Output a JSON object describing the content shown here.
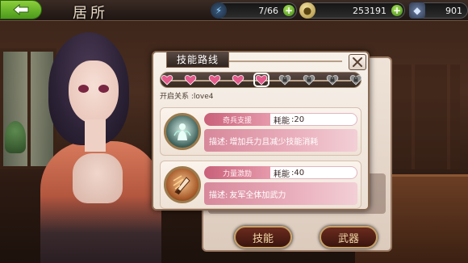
{
  "header": {
    "back_icon": "back-arrow-icon",
    "title": "居所",
    "stats": {
      "energy": {
        "icon": "lightning-icon",
        "value": "7/66"
      },
      "gold": {
        "icon": "coin-icon",
        "value": "253191"
      },
      "gems": {
        "icon": "gem-icon",
        "value": "901"
      }
    }
  },
  "popup": {
    "tab_label": "技能路线",
    "path_nodes": [
      {
        "state": "unlocked",
        "icon": "heart-icon"
      },
      {
        "state": "unlocked",
        "icon": "heart-icon"
      },
      {
        "state": "unlocked",
        "icon": "heart-icon"
      },
      {
        "state": "unlocked",
        "icon": "heart-icon"
      },
      {
        "state": "current",
        "icon": "heart-icon"
      },
      {
        "state": "locked",
        "icon": "lock-icon"
      },
      {
        "state": "locked",
        "icon": "lock-icon"
      },
      {
        "state": "locked",
        "icon": "lock-icon"
      },
      {
        "state": "locked",
        "icon": "lock-icon"
      }
    ],
    "unlock_text": "开启关系 :love4",
    "skills": [
      {
        "name": "奇兵支援",
        "cost_label": "耗能",
        "cost_value": ":20",
        "desc_prefix": "描述:",
        "description": "增加兵力且减少技能消耗",
        "icon": "spirit-figure-icon"
      },
      {
        "name": "力量激励",
        "cost_label": "耗能",
        "cost_value": ":40",
        "desc_prefix": "描述:",
        "description": "友军全体加武力",
        "icon": "power-blade-icon"
      }
    ]
  },
  "buttons": {
    "skill": "技能",
    "weapon": "武器"
  },
  "colors": {
    "accent_pink": "#d7889b",
    "heart_pink": "#e45a8b",
    "topbar_green": "#6bb52c"
  }
}
